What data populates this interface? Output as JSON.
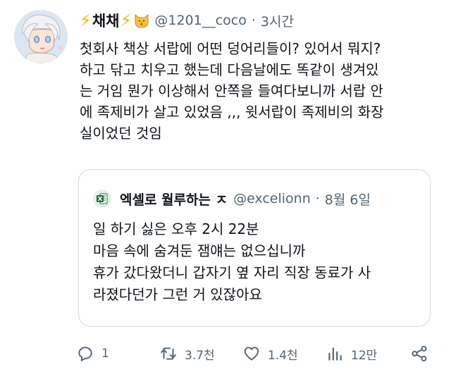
{
  "tweet": {
    "display_name": "채채",
    "handle": "@1201__coco",
    "separator": "·",
    "time": "3시간",
    "text_lines": [
      "첫회사 책상 서랍에 어떤 덩어리들이? 있어서 뭐지?",
      "하고 닦고 치우고 했는데 다음날에도 똑같이 생겨있",
      "는 거임 뭔가 이상해서 안쪽을 들여다보니까 서랍 안",
      "에 족제비가 살고 있었음 ,,, 윗서랍이 족제비의 화장",
      "실이었던 것임"
    ]
  },
  "quote": {
    "display_name": "엑셀로 월루하는 ㅈ",
    "handle": "@excelionn",
    "separator": "·",
    "time": "8월 6일",
    "text_lines": [
      "일 하기 싫은 오후 2시 22분",
      "마음 속에 숨겨둔 잼얘는 없으십니까",
      "휴가 갔다왔더니 갑자기 옆 자리 직장 동료가 사",
      "라졌다던가 그런 거 있잖아요"
    ]
  },
  "actions": {
    "replies": "1",
    "retweets": "3.7천",
    "likes": "1.4천",
    "views": "12만"
  },
  "icons": {
    "bolt": "lightning-bolt-icon",
    "cat": "cat-face-icon",
    "excel": "excel-logo-icon"
  },
  "colors": {
    "text": "#0f1419",
    "secondary": "#536471",
    "border": "#cfd9de",
    "bolt": "#f4b400",
    "excel": "#1d6f42"
  }
}
